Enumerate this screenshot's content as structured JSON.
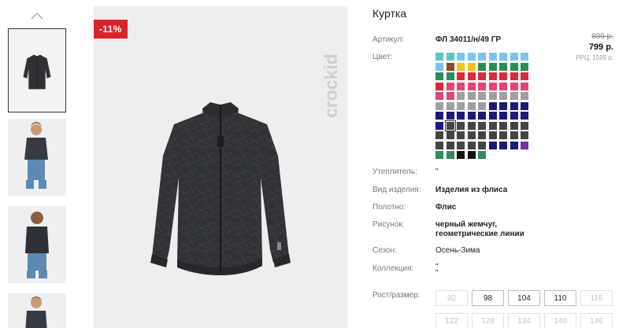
{
  "gallery": {
    "thumbnails": [
      "thumb-jacket-flat",
      "thumb-child-front",
      "thumb-child-back",
      "thumb-child-partial"
    ]
  },
  "image": {
    "discount_badge": "-11%",
    "brand_watermark": "crockid"
  },
  "product": {
    "title": "Куртка",
    "article_label": "Артикул:",
    "article_value": "ФЛ 34011/н/49 ГР",
    "color_label": "Цвет:",
    "price_old": "899 р.",
    "price_new": "799 р.",
    "price_rrc": "РРЦ: 1599 р.",
    "specs": [
      {
        "label": "Утеплитель:",
        "value": "\""
      },
      {
        "label": "Вид изделия:",
        "value": "Изделия из флиса"
      },
      {
        "label": "Полотно:",
        "value": "Флис"
      },
      {
        "label": "Рисунок:",
        "value": "черный жемчуг,",
        "value2": "геометрические линии"
      },
      {
        "label": "Сезон:",
        "value": "Осень-Зима"
      },
      {
        "label": "Коллекция:",
        "value": "\"",
        "value2": "\""
      }
    ],
    "size_label": "Рост/размер:",
    "sizes_row1": [
      {
        "v": "92",
        "on": false
      },
      {
        "v": "98",
        "on": true
      },
      {
        "v": "104",
        "on": true
      },
      {
        "v": "110",
        "on": true
      },
      {
        "v": "116",
        "on": false
      }
    ],
    "sizes_row2": [
      {
        "v": "122",
        "on": false
      },
      {
        "v": "128",
        "on": false
      },
      {
        "v": "134",
        "on": false
      },
      {
        "v": "140",
        "on": false
      },
      {
        "v": "146",
        "on": false
      }
    ]
  },
  "swatch_rows": [
    [
      "#5cc6c6",
      "#5cc6c6",
      "#7cc4f0",
      "#7cc4f0",
      "#7cc4f0",
      "#7cc4f0",
      "#7cc4f0",
      "#7cc4f0",
      "#7cc4f0"
    ],
    [
      "#7cc4f0",
      "#8b4a2b",
      "#f0c419",
      "#f0c419",
      "#2e8b57",
      "#2e8b57",
      "#2e8b57",
      "#2e8b57",
      "#2e8b57"
    ],
    [
      "#2e8b57",
      "#2e8b57",
      "#d92b3a",
      "#d92b3a",
      "#d92b3a",
      "#d92b3a",
      "#d92b3a",
      "#d92b3a",
      "#d92b3a"
    ],
    [
      "#d92b3a",
      "#e0457b",
      "#e0457b",
      "#e0457b",
      "#e0457b",
      "#e0457b",
      "#e0457b",
      "#e0457b",
      "#e0457b"
    ],
    [
      "#e0457b",
      "#e0457b",
      "#a0a0a0",
      "#a0a0a0",
      "#a0a0a0",
      "#a0a0a0",
      "#a0a0a0",
      "#a0a0a0",
      "#a0a0a0"
    ],
    [
      "#a0a0a0",
      "#a0a0a0",
      "#a0a0a0",
      "#a0a0a0",
      "#a0a0a0",
      "#1a1a7a",
      "#1a1a7a",
      "#1a1a7a",
      "#1a1a7a"
    ],
    [
      "#1a1a7a",
      "#1a1a7a",
      "#1a1a7a",
      "#1a1a7a",
      "#1a1a7a",
      "#1a1a7a",
      "#1a1a7a",
      "#1a1a7a",
      "#1a1a7a"
    ],
    [
      "#1a1a7a",
      "#444444",
      "#444444",
      "#444444",
      "#444444",
      "#444444",
      "#444444",
      "#444444",
      "#444444"
    ],
    [
      "#444444",
      "#444444",
      "#444444",
      "#444444",
      "#444444",
      "#444444",
      "#444444",
      "#444444",
      "#444444"
    ],
    [
      "#444444",
      "#444444",
      "#444444",
      "#444444",
      "#444444",
      "#1a1a7a",
      "#1a1a7a",
      "#1a1a7a",
      "#7a2fa8"
    ],
    [
      "#2e8b57",
      "#2e8b57",
      "#111111",
      "#111111",
      "#2e8b57"
    ]
  ],
  "selected_swatch": {
    "row": 7,
    "col": 1
  }
}
